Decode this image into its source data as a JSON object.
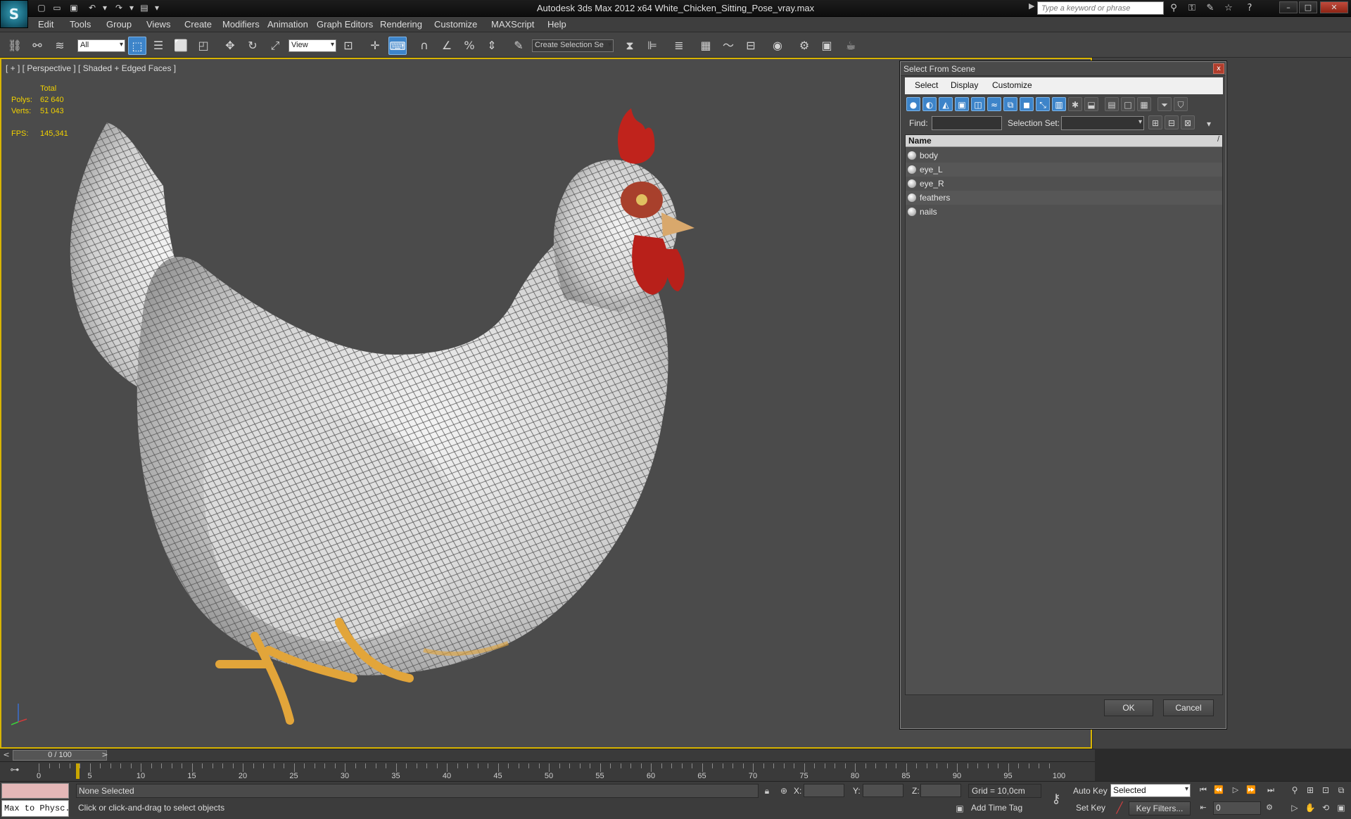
{
  "app": {
    "title": "Autodesk 3ds Max  2012 x64     White_Chicken_Sitting_Pose_vray.max",
    "logo_glyph": "S",
    "search_placeholder": "Type a keyword or phrase"
  },
  "menu": [
    "Edit",
    "Tools",
    "Group",
    "Views",
    "Create",
    "Modifiers",
    "Animation",
    "Graph Editors",
    "Rendering",
    "Customize",
    "MAXScript",
    "Help"
  ],
  "toolbar": {
    "selection_filter": "All",
    "ref_coord": "View",
    "named_selection": "Create Selection Se"
  },
  "viewport": {
    "label": "[ + ] [ Perspective ] [ Shaded + Edged Faces ]",
    "stats": {
      "header": "Total",
      "polys_label": "Polys:",
      "polys_value": "62 640",
      "verts_label": "Verts:",
      "verts_value": "51 043",
      "fps_label": "FPS:",
      "fps_value": "145,341"
    }
  },
  "dialog": {
    "title": "Select From Scene",
    "close_glyph": "x",
    "menus": [
      "Select",
      "Display",
      "Customize"
    ],
    "find_label": "Find:",
    "find_value": "",
    "selset_label": "Selection Set:",
    "selset_value": "",
    "column_header": "Name",
    "sort_glyph": "/",
    "objects": [
      "body",
      "eye_L",
      "eye_R",
      "feathers",
      "nails"
    ],
    "ok_label": "OK",
    "cancel_label": "Cancel"
  },
  "timeline": {
    "slider_text": "0 / 100",
    "ticks": [
      "0",
      "5",
      "10",
      "15",
      "20",
      "25",
      "30",
      "35",
      "40",
      "45",
      "50",
      "55",
      "60",
      "65",
      "70",
      "75",
      "80",
      "85",
      "90",
      "95",
      "100"
    ],
    "prev_glyph": "<",
    "next_glyph": ">"
  },
  "status": {
    "maxscript_text": "Max to Physc.",
    "selection_text": "None Selected",
    "prompt_text": "Click or click-and-drag to select objects",
    "x_label": "X:",
    "y_label": "Y:",
    "z_label": "Z:",
    "grid_text": "Grid = 10,0cm",
    "add_time_tag": "Add Time Tag",
    "auto_key": "Auto Key",
    "set_key": "Set Key",
    "key_mode": "Selected",
    "key_filters": "Key Filters...",
    "current_frame": "0"
  },
  "colors": {
    "viewport_border": "#d8b400",
    "stats_text": "#f0d000",
    "active_tool": "#3d84c9",
    "comb": "#c0231c",
    "feet": "#e2a53a"
  }
}
